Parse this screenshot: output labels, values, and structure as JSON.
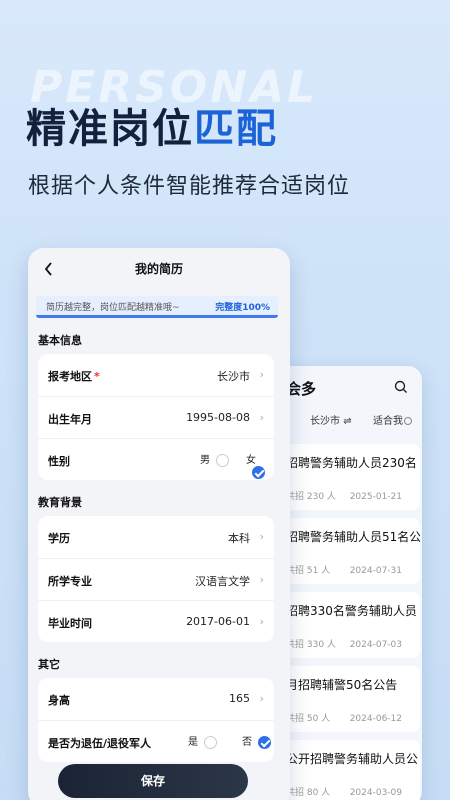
{
  "promo": {
    "watermark": "PERSONAL",
    "headline_main": "精准岗位",
    "headline_accent": "匹配",
    "subline": "根据个人条件智能推荐合适岗位"
  },
  "job_list": {
    "header": "会多",
    "icons": {
      "search": "search-icon"
    },
    "filter_city": "长沙市",
    "filter_city_icon": "⇌",
    "filter_fit": "适合我",
    "jobs": [
      {
        "title": "招聘警务辅助人员230名",
        "meta": "共招 230 人",
        "date": "2025-01-21"
      },
      {
        "title": "招聘警务辅助人员51名公",
        "meta": "共招 51 人",
        "date": "2024-07-31"
      },
      {
        "title": "招聘330名警务辅助人员",
        "meta": "共招 330 人",
        "date": "2024-07-03"
      },
      {
        "title": "月招聘辅警50名公告",
        "meta": "共招 50 人",
        "date": "2024-06-12"
      },
      {
        "title": "公开招聘警务辅助人员公",
        "meta": "共招 80 人",
        "date": "2024-03-09"
      }
    ]
  },
  "resume": {
    "back_icon": "chevron-left-icon",
    "title": "我的简历",
    "progress_hint": "简历越完整，岗位匹配越精准哦~",
    "progress_label": "完整度100%",
    "progress_pct": 100,
    "sections": {
      "basic": "基本信息",
      "education": "教育背景",
      "other": "其它"
    },
    "basic": {
      "region_label": "报考地区",
      "region_required": "*",
      "region_value": "长沙市",
      "birth_label": "出生年月",
      "birth_value": "1995-08-08",
      "gender_label": "性别",
      "gender_male": "男",
      "gender_female": "女",
      "gender_selected": "女"
    },
    "education": {
      "degree_label": "学历",
      "degree_value": "本科",
      "major_label": "所学专业",
      "major_value": "汉语言文学",
      "grad_label": "毕业时间",
      "grad_value": "2017-06-01"
    },
    "other": {
      "height_label": "身高",
      "height_value": "165",
      "veteran_label": "是否为退伍/退役军人",
      "veteran_yes": "是",
      "veteran_no": "否",
      "veteran_selected": "否"
    },
    "save": "保存",
    "chevron": "›"
  }
}
